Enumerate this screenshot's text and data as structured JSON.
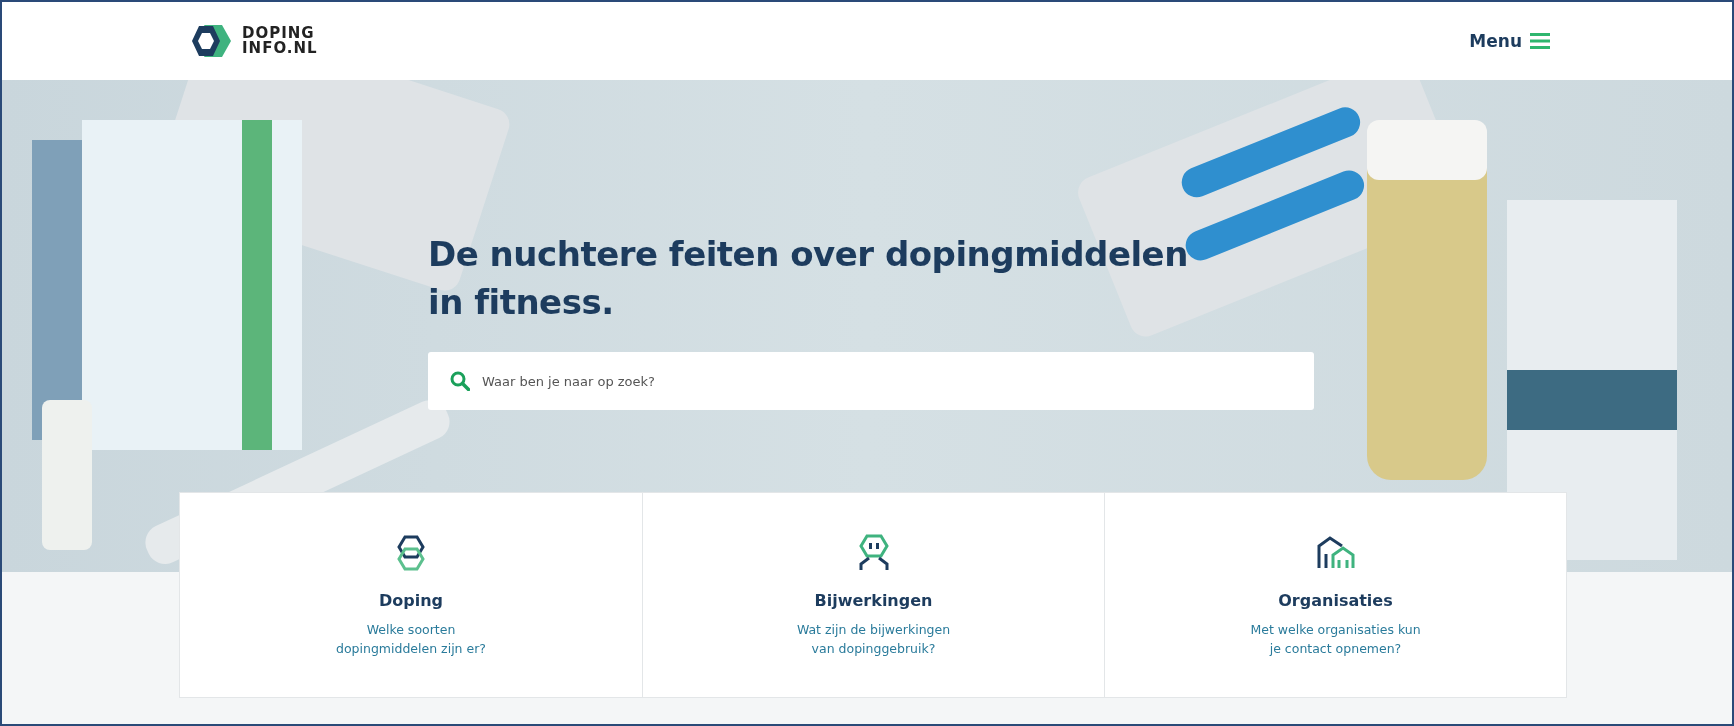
{
  "header": {
    "logo_text": [
      "DOPING",
      "INFO.NL"
    ],
    "menu_label": "Menu"
  },
  "hero": {
    "title": "De nuchtere feiten over dopingmiddelen in fitness.",
    "search": {
      "placeholder": "Waar ben je naar op zoek?"
    }
  },
  "cards": [
    {
      "kind": "doping",
      "title": "Doping",
      "text": [
        "Welke soorten",
        "dopingmiddelen zijn er?"
      ]
    },
    {
      "kind": "side-effects",
      "title": "Bijwerkingen",
      "text": [
        "Wat zijn de bijwerkingen",
        "van dopinggebruik?"
      ]
    },
    {
      "kind": "organisations",
      "title": "Organisaties",
      "text": [
        "Met welke organisaties kun",
        "je contact opnemen?"
      ]
    }
  ]
}
